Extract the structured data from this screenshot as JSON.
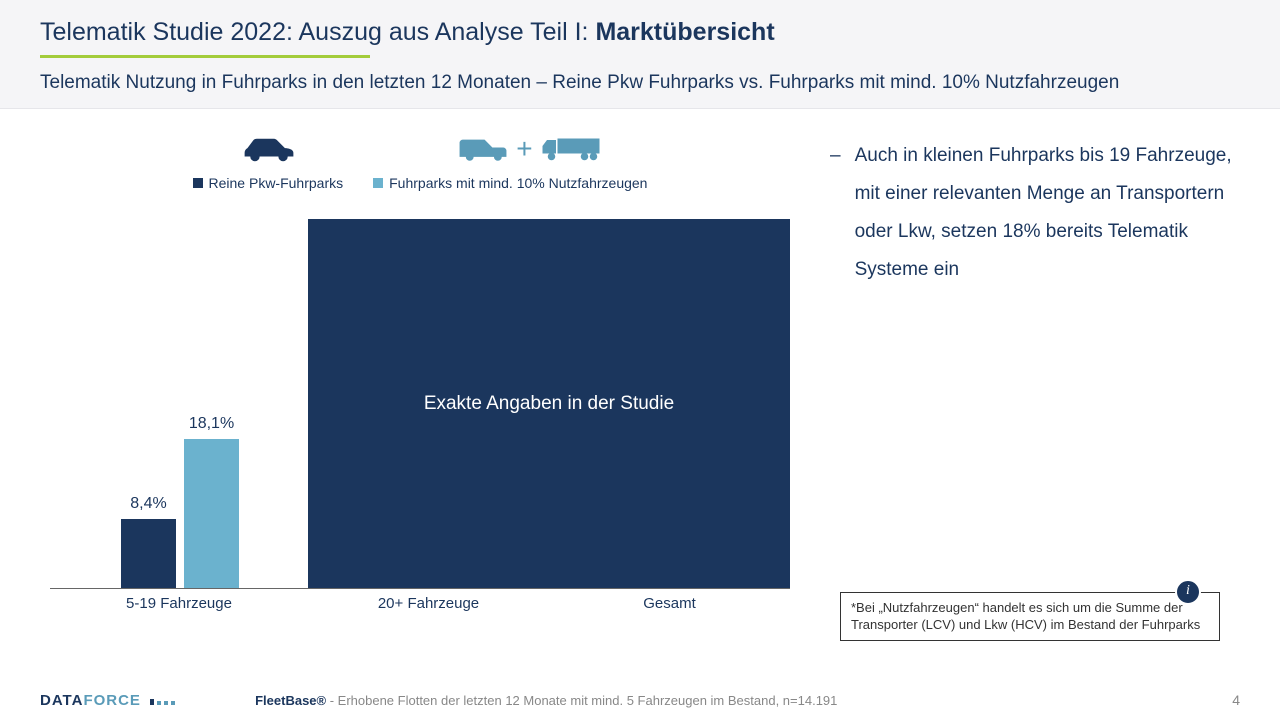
{
  "header": {
    "title_prefix": "Telematik Studie 2022: Auszug aus Analyse Teil I: ",
    "title_bold": "Marktübersicht",
    "subtitle": "Telematik Nutzung in Fuhrparks in den letzten 12 Monaten – Reine Pkw Fuhrparks vs. Fuhrparks mit mind. 10% Nutzfahrzeugen"
  },
  "legend": {
    "series_a": "Reine Pkw-Fuhrparks",
    "series_b": "Fuhrparks mit mind. 10% Nutzfahrzeugen"
  },
  "overlay_text": "Exakte Angaben in der Studie",
  "xaxis": {
    "t1": "5-19 Fahrzeuge",
    "t2": "20+ Fahrzeuge",
    "t3": "Gesamt"
  },
  "bullet_text": "Auch in kleinen Fuhrparks bis 19 Fahrzeuge, mit einer relevanten Menge an Transportern oder Lkw, setzen 18% bereits Telematik Systeme ein",
  "footnote": "*Bei „Nutzfahrzeugen“ handelt es sich um die Summe der Transporter (LCV) und Lkw (HCV) im Bestand der Fuhrparks",
  "footer": {
    "logo_a": "DATA",
    "logo_b": "FORCE",
    "src_bold": "FleetBase®",
    "src_rest": " - Erhobene Flotten der letzten 12 Monate mit mind. 5 Fahrzeugen im Bestand, n=14.191",
    "page": "4"
  },
  "chart_data": {
    "type": "bar",
    "title": "Telematik Nutzung in Fuhrparks in den letzten 12 Monaten – Reine Pkw Fuhrparks vs. Fuhrparks mit mind. 10% Nutzfahrzeugen",
    "categories": [
      "5-19 Fahrzeuge",
      "20+ Fahrzeuge",
      "Gesamt"
    ],
    "series": [
      {
        "name": "Reine Pkw-Fuhrparks",
        "values": [
          8.4,
          null,
          null
        ],
        "labels": [
          "8,4%",
          null,
          null
        ],
        "color": "#1b365d"
      },
      {
        "name": "Fuhrparks mit mind. 10% Nutzfahrzeugen",
        "values": [
          18.1,
          null,
          null
        ],
        "labels": [
          "18,1%",
          null,
          null
        ],
        "color": "#6bb2ce"
      }
    ],
    "ylabel": "",
    "xlabel": "",
    "ylim": [
      0,
      45
    ],
    "note": "Values for '20+ Fahrzeuge' and 'Gesamt' are masked by overlay 'Exakte Angaben in der Studie'"
  }
}
